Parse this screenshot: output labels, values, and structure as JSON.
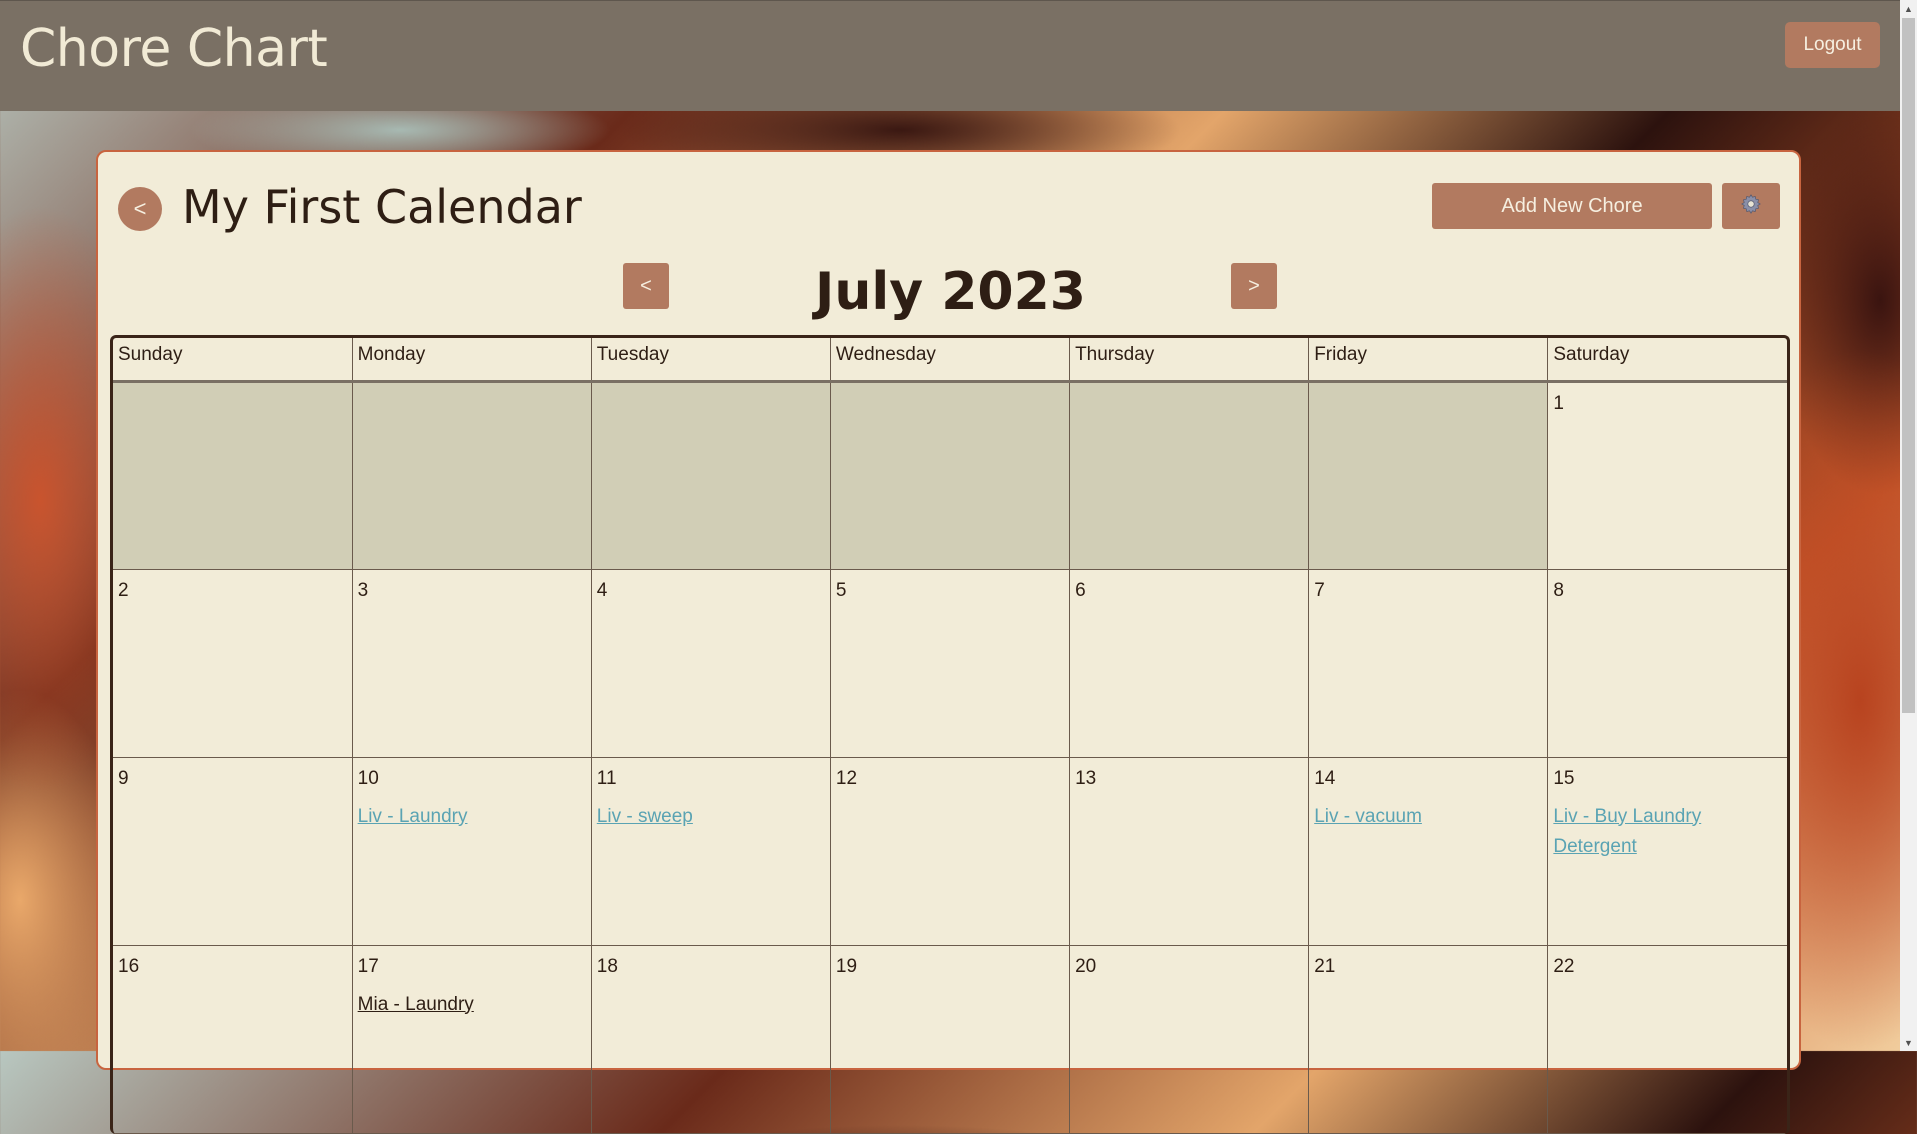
{
  "app": {
    "title": "Chore Chart",
    "logout_label": "Logout"
  },
  "calendar": {
    "name": "My First Calendar",
    "back_label": "<",
    "add_chore_label": "Add New Chore",
    "settings_icon": "gear-icon",
    "prev_label": "<",
    "next_label": ">",
    "month_label": "July 2023",
    "weekdays": [
      "Sunday",
      "Monday",
      "Tuesday",
      "Wednesday",
      "Thursday",
      "Friday",
      "Saturday"
    ],
    "weeks": [
      [
        {
          "day": ""
        },
        {
          "day": ""
        },
        {
          "day": ""
        },
        {
          "day": ""
        },
        {
          "day": ""
        },
        {
          "day": ""
        },
        {
          "day": "1",
          "chores": []
        }
      ],
      [
        {
          "day": "2",
          "chores": []
        },
        {
          "day": "3",
          "chores": []
        },
        {
          "day": "4",
          "chores": []
        },
        {
          "day": "5",
          "chores": []
        },
        {
          "day": "6",
          "chores": []
        },
        {
          "day": "7",
          "chores": []
        },
        {
          "day": "8",
          "chores": []
        }
      ],
      [
        {
          "day": "9",
          "chores": []
        },
        {
          "day": "10",
          "chores": [
            "Liv - Laundry"
          ]
        },
        {
          "day": "11",
          "chores": [
            "Liv - sweep"
          ]
        },
        {
          "day": "12",
          "chores": []
        },
        {
          "day": "13",
          "chores": []
        },
        {
          "day": "14",
          "chores": [
            "Liv - vacuum"
          ]
        },
        {
          "day": "15",
          "chores": [
            "Liv - Buy Laundry Detergent"
          ]
        }
      ],
      [
        {
          "day": "16",
          "chores": []
        },
        {
          "day": "17",
          "chores": [
            "Mia - Laundry"
          ],
          "chore_status": [
            "done"
          ]
        },
        {
          "day": "18",
          "chores": []
        },
        {
          "day": "19",
          "chores": []
        },
        {
          "day": "20",
          "chores": []
        },
        {
          "day": "21",
          "chores": []
        },
        {
          "day": "22",
          "chores": []
        }
      ]
    ]
  },
  "colors": {
    "header_bg": "#7a7064",
    "button_bg": "#b27a60",
    "card_bg": "#f2ecd8",
    "card_border": "#c8643f",
    "empty_cell": "#d1ceb6",
    "chore_link": "#5aa3b3"
  }
}
